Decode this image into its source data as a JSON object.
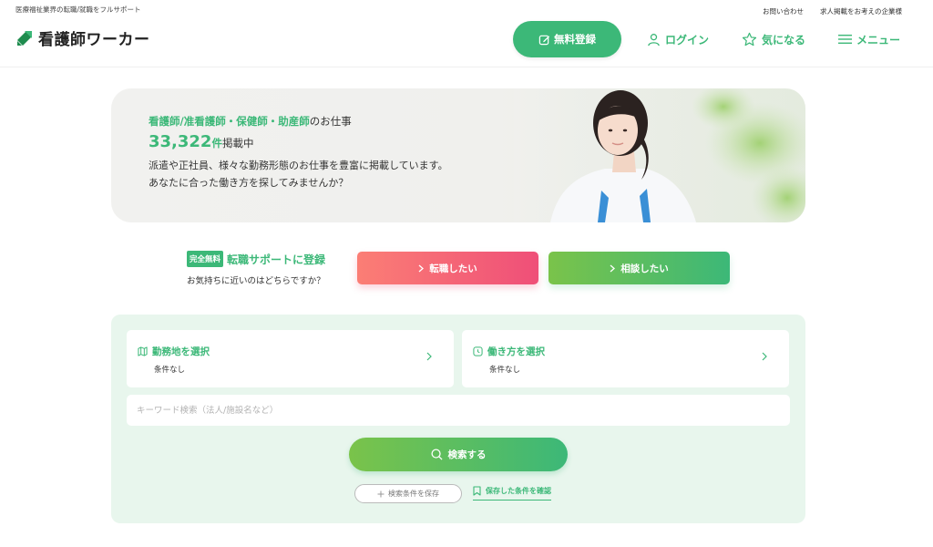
{
  "header": {
    "tagline": "医療福祉業界の転職/就職をフルサポート",
    "logo_text": "看護師ワーカー",
    "top_links": [
      "お問い合わせ",
      "求人掲載をお考えの企業様"
    ],
    "nav": {
      "register": "無料登録",
      "login": "ログイン",
      "favorite": "気になる",
      "menu": "メニュー"
    }
  },
  "hero": {
    "line1_green": "看護師/准看護師・保健師・助産師",
    "line1_suffix": "のお仕事",
    "count": "33,322",
    "count_unit": "件",
    "count_suffix": "掲載中",
    "desc_line1": "派遣や正社員、様々な勤務形態のお仕事を豊富に掲載しています。",
    "desc_line2": "あなたに合った働き方を探してみませんか？"
  },
  "cta": {
    "badge": "完全無料",
    "title": "転職サポートに登録",
    "subtitle": "お気持ちに近いのはどちらですか？",
    "change_button": "転職したい",
    "consult_button": "相談したい"
  },
  "search": {
    "location": {
      "title": "勤務地を選択",
      "value": "条件なし"
    },
    "workstyle": {
      "title": "働き方を選択",
      "value": "条件なし"
    },
    "keyword_placeholder": "キーワード検索（法人/施設名など）",
    "search_button": "検索する",
    "save_button": "検索条件を保存",
    "saved_link": "保存した条件を確認"
  },
  "colors": {
    "brand_green": "#3cb878",
    "pink_start": "#fb7e75",
    "pink_end": "#ef4f78",
    "panel_bg": "#e8f6ed"
  },
  "icons": [
    "logo-mark-icon",
    "pencil-square-icon",
    "user-icon",
    "star-icon",
    "hamburger-icon",
    "chevron-right-icon",
    "map-icon",
    "clock-icon",
    "search-icon",
    "plus-icon",
    "bookmark-icon"
  ]
}
